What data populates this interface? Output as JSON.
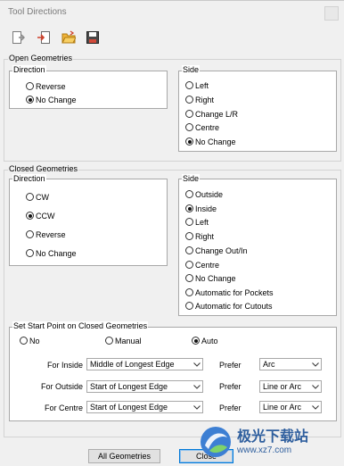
{
  "window": {
    "title": "Tool Directions"
  },
  "toolbar": [
    {
      "icon": "import-icon"
    },
    {
      "icon": "export-icon"
    },
    {
      "icon": "open-folder-icon"
    },
    {
      "icon": "save-icon"
    }
  ],
  "open_geometries": {
    "title": "Open Geometries",
    "direction": {
      "title": "Direction",
      "options": [
        {
          "label": "Reverse",
          "selected": false
        },
        {
          "label": "No Change",
          "selected": true
        }
      ]
    },
    "side": {
      "title": "Side",
      "options": [
        {
          "label": "Left",
          "selected": false
        },
        {
          "label": "Right",
          "selected": false
        },
        {
          "label": "Change L/R",
          "selected": false
        },
        {
          "label": "Centre",
          "selected": false
        },
        {
          "label": "No Change",
          "selected": true
        }
      ]
    }
  },
  "closed_geometries": {
    "title": "Closed Geometries",
    "direction": {
      "title": "Direction",
      "options": [
        {
          "label": "CW",
          "selected": false
        },
        {
          "label": "CCW",
          "selected": true
        },
        {
          "label": "Reverse",
          "selected": false
        },
        {
          "label": "No Change",
          "selected": false
        }
      ]
    },
    "side": {
      "title": "Side",
      "options": [
        {
          "label": "Outside",
          "selected": false
        },
        {
          "label": "Inside",
          "selected": true
        },
        {
          "label": "Left",
          "selected": false
        },
        {
          "label": "Right",
          "selected": false
        },
        {
          "label": "Change Out/In",
          "selected": false
        },
        {
          "label": "Centre",
          "selected": false
        },
        {
          "label": "No Change",
          "selected": false
        },
        {
          "label": "Automatic for Pockets",
          "selected": false
        },
        {
          "label": "Automatic for Cutouts",
          "selected": false
        }
      ]
    }
  },
  "start_point": {
    "title": "Set Start Point on Closed Geometries",
    "modes": [
      {
        "label": "No",
        "selected": false
      },
      {
        "label": "Manual",
        "selected": false
      },
      {
        "label": "Auto",
        "selected": true
      }
    ],
    "rows": [
      {
        "label": "For Inside",
        "value": "Middle of Longest Edge",
        "prefer_label": "Prefer",
        "prefer_value": "Arc"
      },
      {
        "label": "For Outside",
        "value": "Start of Longest Edge",
        "prefer_label": "Prefer",
        "prefer_value": "Line or Arc"
      },
      {
        "label": "For Centre",
        "value": "Start of Longest Edge",
        "prefer_label": "Prefer",
        "prefer_value": "Line or Arc"
      }
    ]
  },
  "buttons": {
    "all_geometries": "All Geometries",
    "close": "Close"
  },
  "watermark": {
    "text": "极光下载站",
    "url": "www.xz7.com"
  }
}
